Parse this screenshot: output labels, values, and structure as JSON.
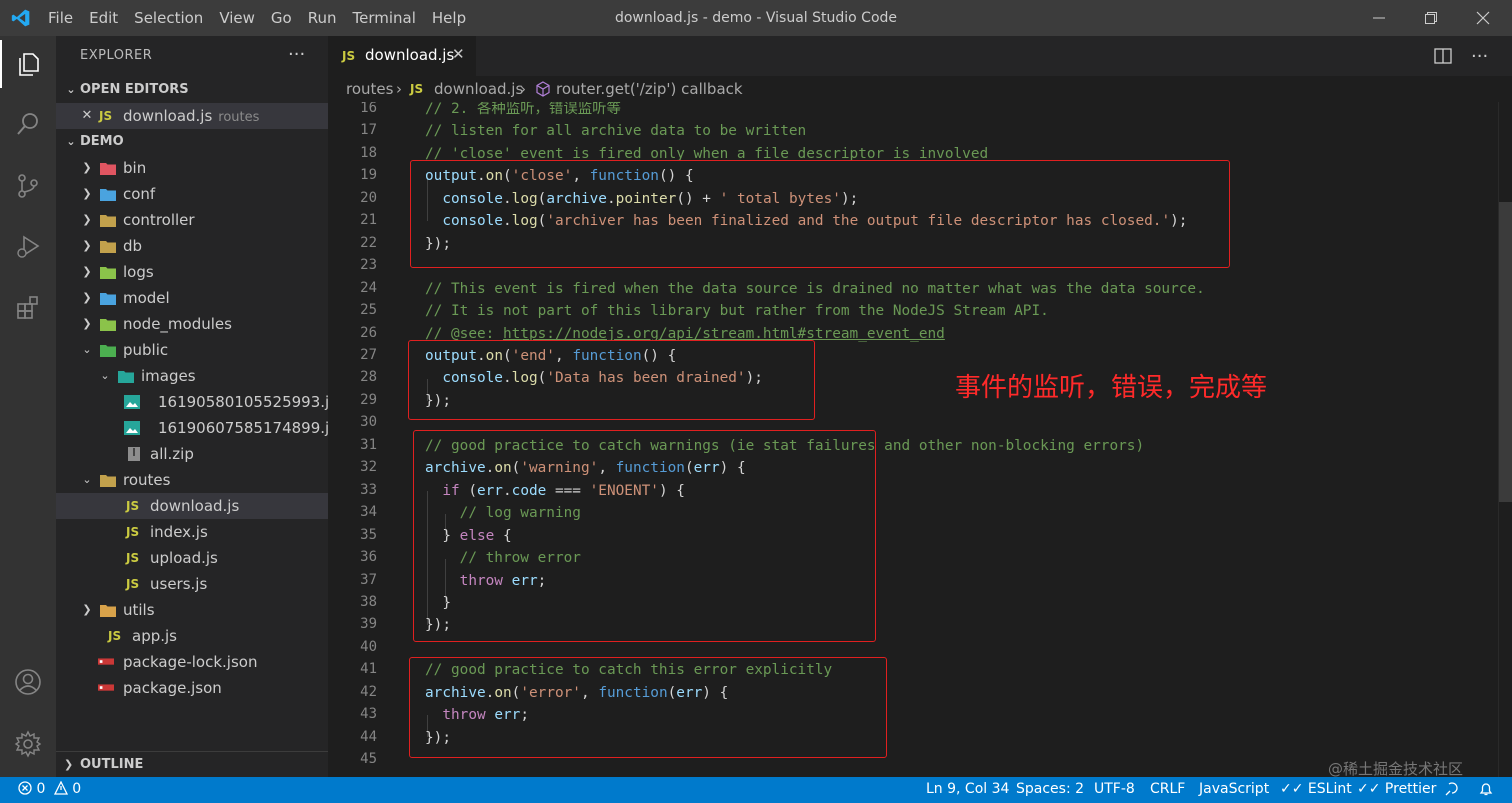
{
  "window": {
    "title": "download.js - demo - Visual Studio Code",
    "menu": [
      "File",
      "Edit",
      "Selection",
      "View",
      "Go",
      "Run",
      "Terminal",
      "Help"
    ]
  },
  "activity_bar": [
    "explorer-icon",
    "search-icon",
    "source-control-icon",
    "run-debug-icon",
    "extensions-icon",
    "account-icon",
    "settings-gear-icon"
  ],
  "sidebar": {
    "title": "EXPLORER",
    "more": "···",
    "open_editors_label": "OPEN EDITORS",
    "open_editor": {
      "name": "download.js",
      "hint": "routes",
      "badge": "JS"
    },
    "project_label": "DEMO",
    "tree": [
      {
        "name": "bin",
        "type": "folder",
        "expanded": false
      },
      {
        "name": "conf",
        "type": "folder",
        "expanded": false
      },
      {
        "name": "controller",
        "type": "folder",
        "expanded": false
      },
      {
        "name": "db",
        "type": "folder",
        "expanded": false
      },
      {
        "name": "logs",
        "type": "folder",
        "expanded": false
      },
      {
        "name": "model",
        "type": "folder",
        "expanded": false
      },
      {
        "name": "node_modules",
        "type": "folder",
        "expanded": false
      },
      {
        "name": "public",
        "type": "folder",
        "expanded": true
      },
      {
        "name": "images",
        "type": "folder",
        "expanded": true
      },
      {
        "name": "16190580105525993.jpg",
        "type": "image"
      },
      {
        "name": "16190607585174899.jpg",
        "type": "image"
      },
      {
        "name": "all.zip",
        "type": "zip"
      },
      {
        "name": "routes",
        "type": "folder",
        "expanded": true
      },
      {
        "name": "download.js",
        "type": "js",
        "selected": true
      },
      {
        "name": "index.js",
        "type": "js"
      },
      {
        "name": "upload.js",
        "type": "js"
      },
      {
        "name": "users.js",
        "type": "js"
      },
      {
        "name": "utils",
        "type": "folder",
        "expanded": false
      },
      {
        "name": "app.js",
        "type": "js"
      },
      {
        "name": "package-lock.json",
        "type": "json"
      },
      {
        "name": "package.json",
        "type": "json"
      }
    ],
    "outline_label": "OUTLINE"
  },
  "tab": {
    "badge": "JS",
    "name": "download.js",
    "close": "✕"
  },
  "breadcrumb": {
    "folder": "routes",
    "file_badge": "JS",
    "file": "download.js",
    "symbol": "router.get('/zip') callback"
  },
  "editor": {
    "line_numbers": [
      "16",
      "17",
      "18",
      "19",
      "20",
      "21",
      "22",
      "23",
      "24",
      "25",
      "26",
      "27",
      "28",
      "29",
      "30",
      "31",
      "32",
      "33",
      "34",
      "35",
      "36",
      "37",
      "38",
      "39",
      "40",
      "41",
      "42",
      "43",
      "44",
      "45"
    ],
    "annotation": "事件的监听，错误，完成等"
  },
  "status_bar": {
    "errors": "0",
    "warnings": "0",
    "position": "Ln 9, Col 34",
    "spaces": "Spaces: 2",
    "encoding": "UTF-8",
    "eol": "CRLF",
    "language": "JavaScript",
    "eslint": "ESLint",
    "prettier": "Prettier"
  },
  "watermark": "@稀土掘金技术社区",
  "colors": {
    "accent": "#007acc",
    "annotation_red": "#e02020",
    "js_badge": "#cbcb41"
  }
}
